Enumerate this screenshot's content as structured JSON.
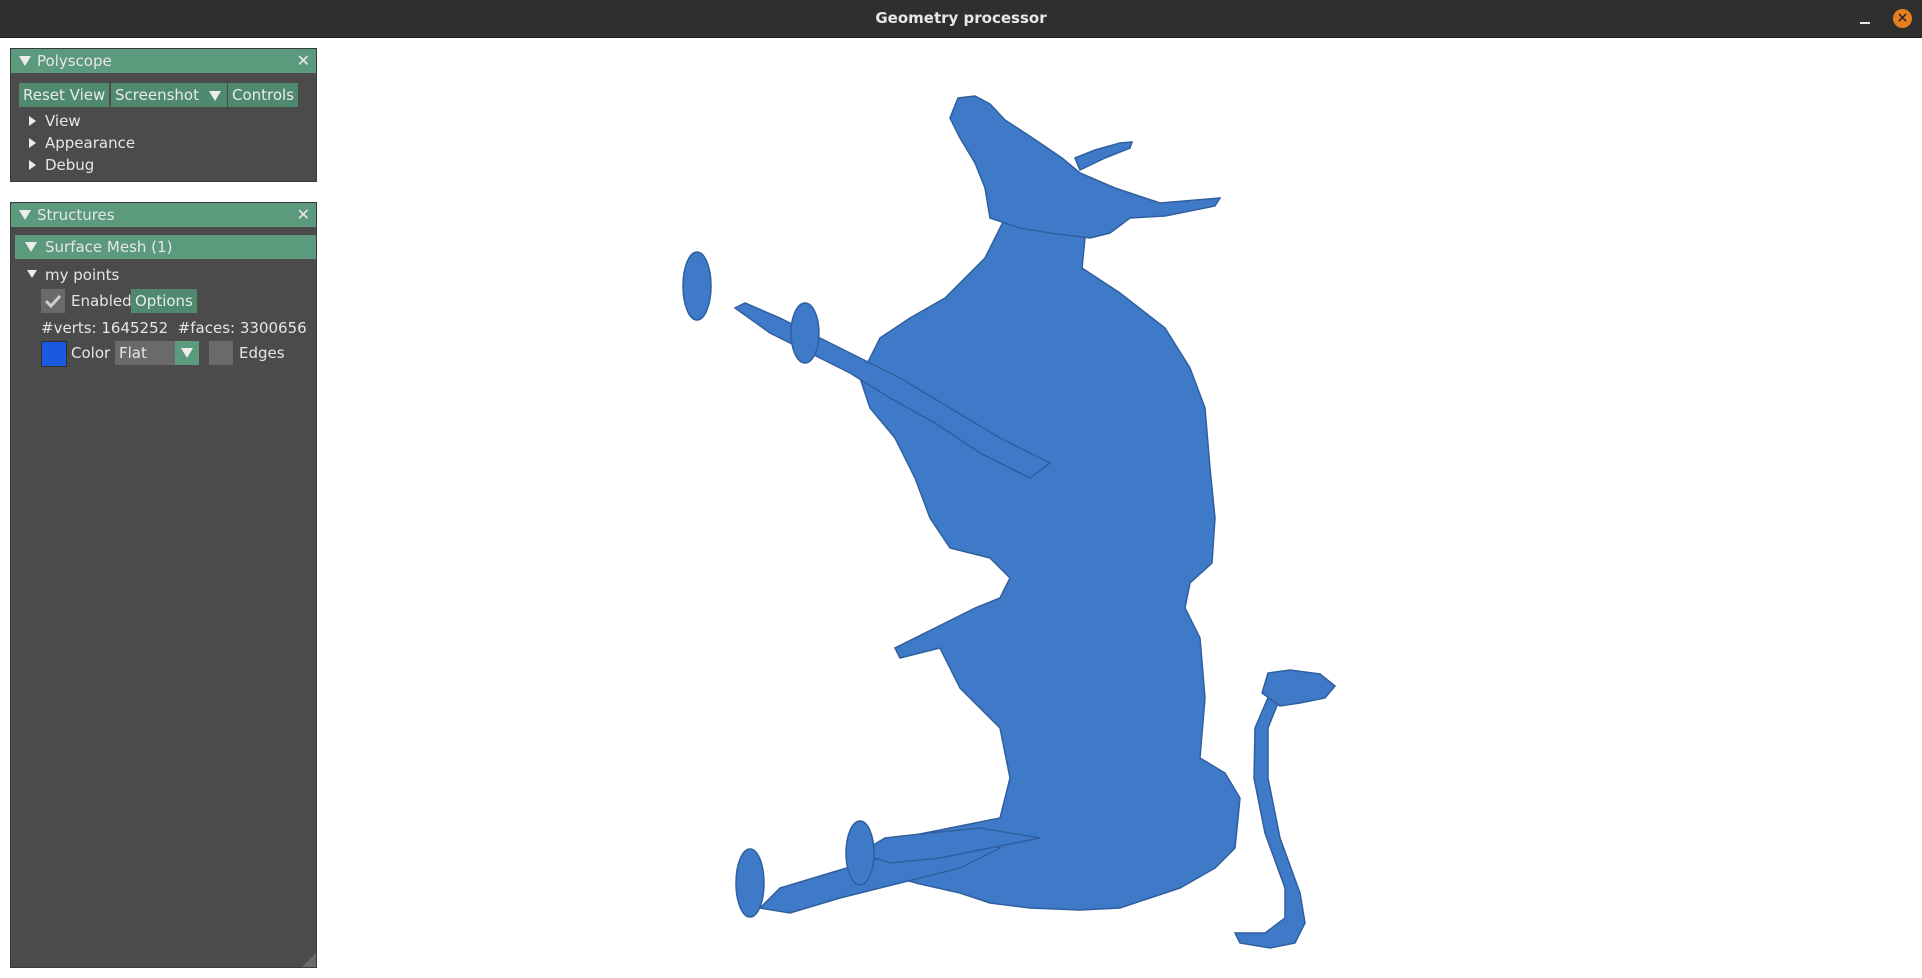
{
  "window": {
    "title": "Geometry processor",
    "close_glyph": "×"
  },
  "polyscope_panel": {
    "title": "Polyscope",
    "close_glyph": "✕",
    "buttons": {
      "reset_view": "Reset View",
      "screenshot": "Screenshot",
      "controls": "Controls"
    },
    "tree": [
      "View",
      "Appearance",
      "Debug"
    ]
  },
  "structures_panel": {
    "title": "Structures",
    "close_glyph": "✕",
    "group_header": "Surface Mesh (1)",
    "item": {
      "name": "my points",
      "enabled_label": "Enabled",
      "enabled": true,
      "options_label": "Options",
      "stats": "#verts: 1645252  #faces: 3300656",
      "color_label": "Color",
      "color_value": "#1a59e0",
      "shade_mode": "Flat",
      "edges_label": "Edges"
    }
  },
  "colors": {
    "accent": "#5c9a7e",
    "panel": "#4b4b4b",
    "mesh": "#3f7ac9"
  }
}
